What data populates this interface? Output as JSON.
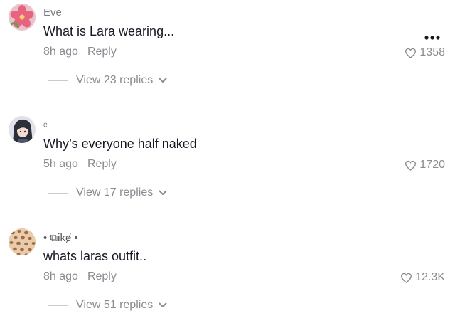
{
  "comments": [
    {
      "username": "Eve",
      "text": "What is Lara wearing...",
      "time": "8h ago",
      "reply_label": "Reply",
      "likes": "1358",
      "view_replies": "View 23 replies",
      "avatar_icon": "flower-avatar-icon"
    },
    {
      "username": "ᵉ",
      "text": "Why’s everyone half naked",
      "time": "5h ago",
      "reply_label": "Reply",
      "likes": "1720",
      "view_replies": "View 17 replies",
      "avatar_icon": "anime-character-avatar-icon"
    },
    {
      "username": "• ⧉ikɇ •",
      "text": "whats laras outfit..",
      "time": "8h ago",
      "reply_label": "Reply",
      "likes": "12.3K",
      "view_replies": "View 51 replies",
      "avatar_icon": "leopard-print-avatar-icon"
    }
  ],
  "more_icon": "more-options-icon",
  "colors": {
    "text_primary": "#161823",
    "text_secondary": "#8a8b91",
    "divider": "#c9cacd"
  }
}
